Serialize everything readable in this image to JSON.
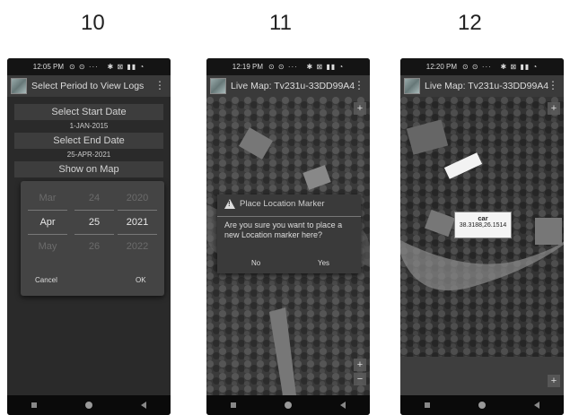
{
  "figure_numbers": [
    "10",
    "11",
    "12"
  ],
  "screen10": {
    "status_time": "12:05 PM",
    "title": "Select Period to View Logs",
    "start_button": "Select Start Date",
    "start_date": "1-JAN-2015",
    "end_button": "Select End Date",
    "end_date": "25-APR-2021",
    "show_button": "Show on Map",
    "picker": {
      "months": [
        "Mar",
        "Apr",
        "May"
      ],
      "days": [
        "24",
        "25",
        "26"
      ],
      "years": [
        "2020",
        "2021",
        "2022"
      ],
      "cancel": "Cancel",
      "ok": "OK"
    }
  },
  "screen11": {
    "status_time": "12:19 PM",
    "title": "Live Map: Tv231u-33DD99A4",
    "dialog": {
      "title": "Place Location Marker",
      "message": "Are you sure you want to place a new Location marker here?",
      "no": "No",
      "yes": "Yes"
    }
  },
  "screen12": {
    "status_time": "12:20 PM",
    "title": "Live Map: Tv231u-33DD99A4",
    "marker": {
      "name": "car",
      "coords": "38.3188,26.1514"
    }
  },
  "icons": {
    "overflow": "overflow-menu-icon",
    "zoom_in": "+",
    "zoom_out": "−"
  }
}
